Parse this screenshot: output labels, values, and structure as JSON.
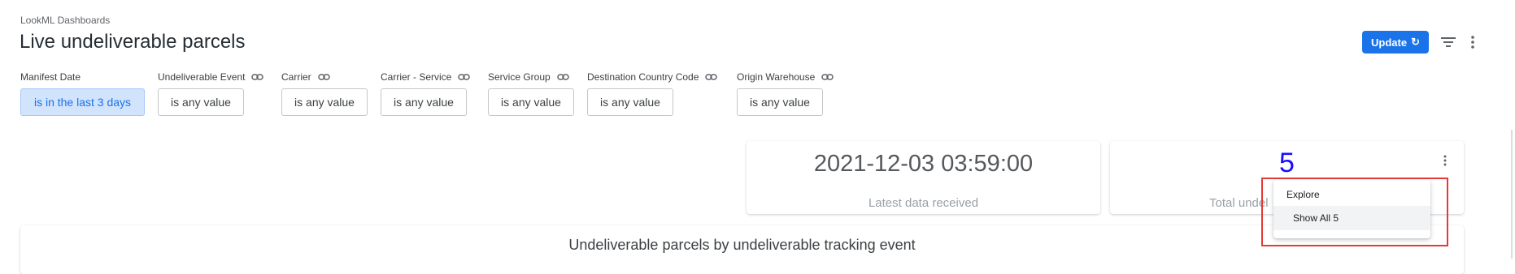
{
  "breadcrumb": "LookML Dashboards",
  "title": "Live undeliverable parcels",
  "header": {
    "update_label": "Update",
    "update_icon": "refresh-icon",
    "filter_icon": "filter-list-icon",
    "more_icon": "more-vert-icon",
    "accent_color": "#1a73e8"
  },
  "filters": [
    {
      "label": "Manifest Date",
      "value": "is in the last 3 days",
      "active": true,
      "linked": false
    },
    {
      "label": "Undeliverable Event",
      "value": "is any value",
      "active": false,
      "linked": true
    },
    {
      "label": "Carrier",
      "value": "is any value",
      "active": false,
      "linked": true
    },
    {
      "label": "Carrier - Service",
      "value": "is any value",
      "active": false,
      "linked": true
    },
    {
      "label": "Service Group",
      "value": "is any value",
      "active": false,
      "linked": true
    },
    {
      "label": "Destination Country Code",
      "value": "is any value",
      "active": false,
      "linked": true
    },
    {
      "label": "Origin Warehouse",
      "value": "is any value",
      "active": false,
      "linked": true
    }
  ],
  "tiles": {
    "latest": {
      "value": "2021-12-03 03:59:00",
      "label": "Latest data received"
    },
    "total": {
      "value": "5",
      "label": "Total undel",
      "value_color": "#1a0dff"
    },
    "chart": {
      "title": "Undeliverable parcels by undeliverable tracking event"
    }
  },
  "menu": {
    "header": "Explore",
    "item": "Show All 5",
    "highlight_color": "#e53935"
  }
}
